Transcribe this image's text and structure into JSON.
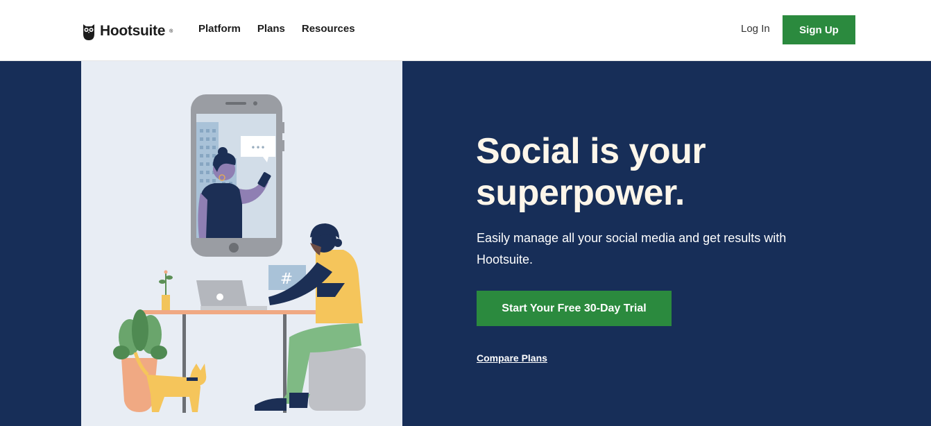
{
  "header": {
    "logo_text": "Hootsuite",
    "nav": [
      {
        "label": "Platform"
      },
      {
        "label": "Plans"
      },
      {
        "label": "Resources"
      }
    ],
    "login_label": "Log In",
    "signup_label": "Sign Up"
  },
  "hero": {
    "headline_line1": "Social is your",
    "headline_line2": "superpower.",
    "subtext": "Easily manage all your social media and get results with Hootsuite.",
    "cta_label": "Start Your Free 30-Day Trial",
    "compare_label": "Compare Plans",
    "speech_bubble_dots": "•••",
    "hashtag": "#"
  },
  "colors": {
    "brand_navy": "#172e58",
    "cta_green": "#2b8a3e",
    "headline_cream": "#fdf6ea",
    "illustration_bg": "#e8edf4"
  },
  "icons": [
    "owl-logo-icon"
  ]
}
